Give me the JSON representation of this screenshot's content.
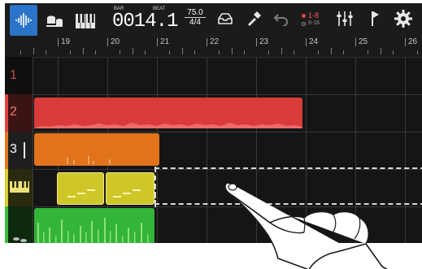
{
  "toolbar": {
    "counter_bar_label": "BAR",
    "counter_beat_label": "BEAT",
    "counter_value": "0014.1",
    "tempo": "75.0",
    "time_signature": "4/4",
    "track_select_top": "1-8",
    "track_select_bottom": "9-16",
    "icons": [
      "waveform-icon",
      "drum-icon",
      "piano-icon",
      "undo-icon",
      "mixer-icon",
      "marker-icon",
      "gear-icon",
      "save-icon",
      "tool-icon"
    ]
  },
  "ruler": {
    "bars": [
      "19",
      "20",
      "21",
      "22",
      "23",
      "24",
      "25",
      "26"
    ]
  },
  "tracks": [
    {
      "label": "1",
      "color": "#c84a4a",
      "type": "audio"
    },
    {
      "label": "2",
      "color": "#e0413f",
      "type": "audio"
    },
    {
      "label": "3",
      "color": "#e2781f",
      "type": "audio"
    },
    {
      "label": "",
      "color": "#d7cf33",
      "type": "midi",
      "icon": "piano-icon"
    },
    {
      "label": "",
      "color": "#3dbb3f",
      "type": "drum",
      "icon": "drum-icon"
    }
  ],
  "colors": {
    "accent": "#2a74c9",
    "track2": "#d93b3b",
    "track3": "#e0731b",
    "track4": "#cfc62a",
    "track5": "#33b537"
  }
}
